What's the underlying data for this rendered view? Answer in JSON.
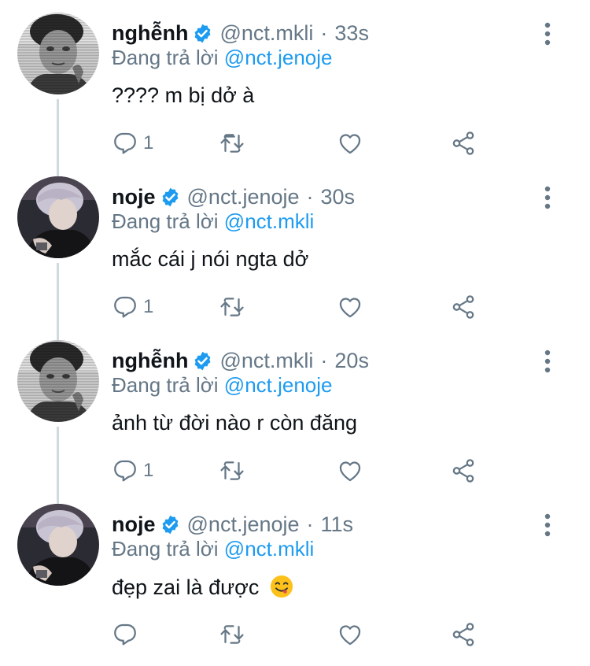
{
  "tweets": [
    {
      "name": "nghễnh",
      "handle": "@nct.mkli",
      "time": "33s",
      "reply_prefix": "Đang trả lời",
      "reply_to": "@nct.jenoje",
      "text": "???? m bị dở à",
      "reply_count": "1",
      "avatar": "avatar-mkli"
    },
    {
      "name": "noje",
      "handle": "@nct.jenoje",
      "time": "30s",
      "reply_prefix": "Đang trả lời",
      "reply_to": "@nct.mkli",
      "text": "mắc cái j nói ngta dở",
      "reply_count": "1",
      "avatar": "avatar-jenoje"
    },
    {
      "name": "nghễnh",
      "handle": "@nct.mkli",
      "time": "20s",
      "reply_prefix": "Đang trả lời",
      "reply_to": "@nct.jenoje",
      "text": "ảnh từ đời nào r còn đăng",
      "reply_count": "1",
      "avatar": "avatar-mkli"
    },
    {
      "name": "noje",
      "handle": "@nct.jenoje",
      "time": "11s",
      "reply_prefix": "Đang trả lời",
      "reply_to": "@nct.mkli",
      "text": "đẹp zai là được",
      "reply_count": "",
      "avatar": "avatar-jenoje",
      "emoji": "savoring-food-emoji"
    }
  ],
  "icons": {
    "reply": "reply-icon",
    "retweet": "retweet-icon",
    "like": "like-icon",
    "share": "share-icon",
    "more": "more-icon",
    "verified": "verified-badge-icon"
  },
  "colors": {
    "text": "#0f1419",
    "secondary": "#657786",
    "link": "#1d9bf0",
    "verified": "#1d9bf0",
    "thread_line": "#cfd9de"
  }
}
